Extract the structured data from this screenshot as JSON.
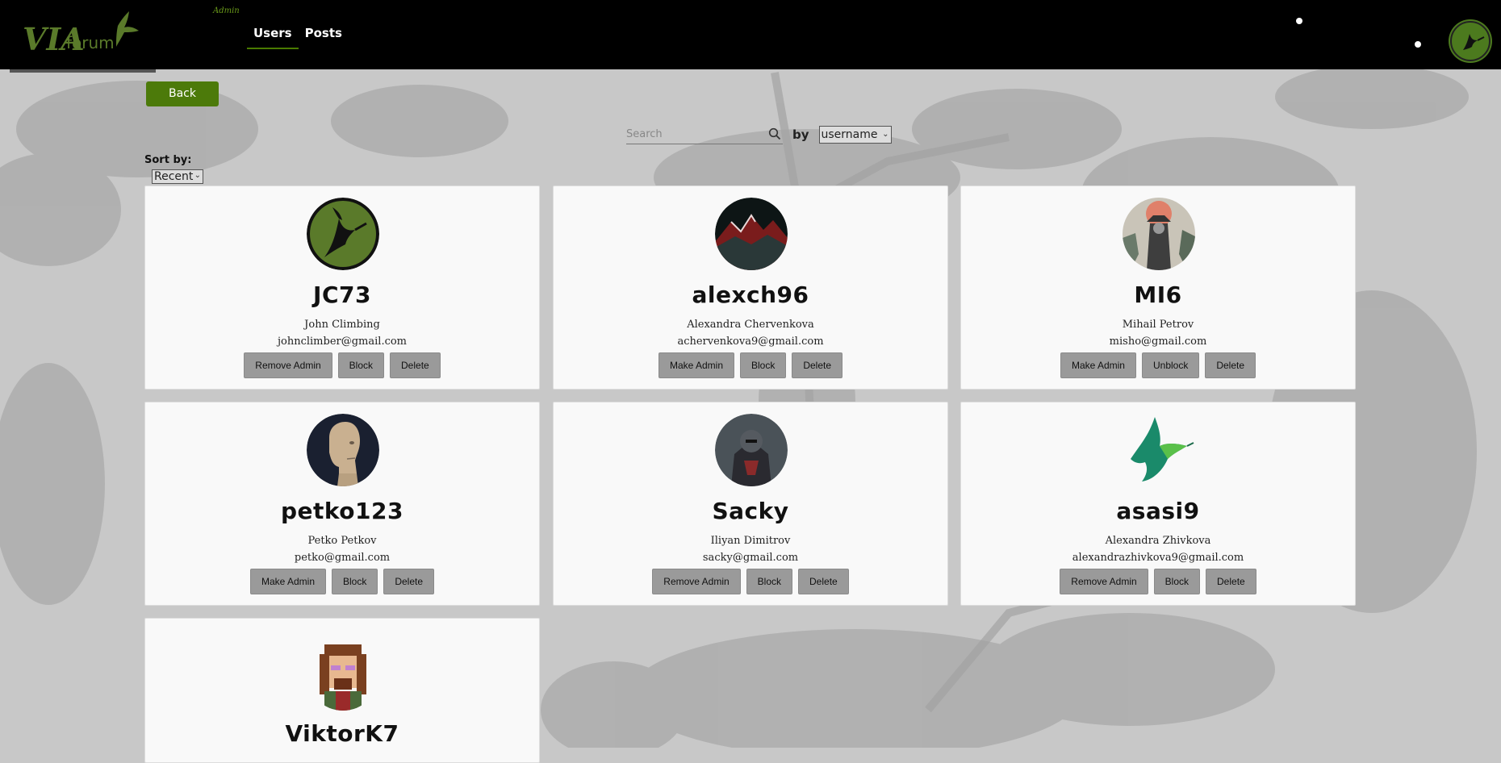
{
  "header": {
    "brand_via": "VIA",
    "brand_forum": "forum",
    "admin_tag": "Admin",
    "nav": [
      {
        "label": "Users",
        "active": true
      },
      {
        "label": "Posts",
        "active": false
      }
    ]
  },
  "toolbar": {
    "back_label": "Back",
    "search_placeholder": "Search",
    "by_label": "by",
    "by_value": "username",
    "sort_label": "Sort by:",
    "sort_value": "Recent"
  },
  "users": [
    {
      "username": "JC73",
      "full_name": "John Climbing",
      "email": "johnclimber@gmail.com",
      "admin_action": "Remove Admin",
      "block_action": "Block",
      "delete_action": "Delete",
      "avatar": "hummingbird-green"
    },
    {
      "username": "alexch96",
      "full_name": "Alexandra Chervenkova",
      "email": "achervenkova9@gmail.com",
      "admin_action": "Make Admin",
      "block_action": "Block",
      "delete_action": "Delete",
      "avatar": "red-mountain"
    },
    {
      "username": "MI6",
      "full_name": "Mihail Petrov",
      "email": "misho@gmail.com",
      "admin_action": "Make Admin",
      "block_action": "Unblock",
      "delete_action": "Delete",
      "avatar": "samurai"
    },
    {
      "username": "petko123",
      "full_name": "Petko Petkov",
      "email": "petko@gmail.com",
      "admin_action": "Make Admin",
      "block_action": "Block",
      "delete_action": "Delete",
      "avatar": "meme-man"
    },
    {
      "username": "Sacky",
      "full_name": "Iliyan Dimitrov",
      "email": "sacky@gmail.com",
      "admin_action": "Remove Admin",
      "block_action": "Block",
      "delete_action": "Delete",
      "avatar": "dark-warrior"
    },
    {
      "username": "asasi9",
      "full_name": "Alexandra Zhivkova",
      "email": "alexandrazhivkova9@gmail.com",
      "admin_action": "Remove Admin",
      "block_action": "Block",
      "delete_action": "Delete",
      "avatar": "teal-bird"
    },
    {
      "username": "ViktorK7",
      "full_name": "",
      "email": "",
      "admin_action": "",
      "block_action": "",
      "delete_action": "",
      "avatar": "pixel-man"
    }
  ],
  "colors": {
    "header_bg": "#000000",
    "accent_green": "#4c7a0a",
    "button_gray": "#9a9a9a",
    "card_bg": "#f9f9f9"
  }
}
